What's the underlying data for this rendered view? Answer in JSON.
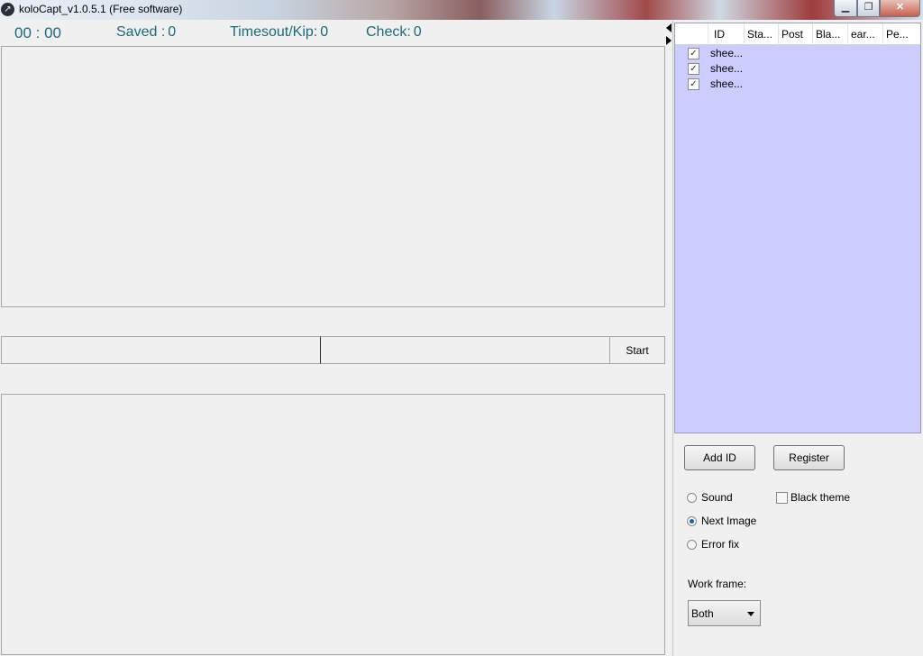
{
  "window": {
    "title": "koloCapt_v1.0.5.1 (Free software)",
    "icon": "app-icon",
    "controls": {
      "minimize": "minimize-icon",
      "maximize": "maximize-icon",
      "close": "close-icon"
    }
  },
  "stats": {
    "timer": "00 : 00",
    "saved_label": "Saved :",
    "saved_value": "0",
    "timeout_label": "Timesout/Kip:",
    "timeout_value": "0",
    "check_label": "Check:",
    "check_value": "0"
  },
  "controls": {
    "start_label": "Start",
    "input1_value": "",
    "input2_value": ""
  },
  "account_list": {
    "columns": [
      "",
      "ID",
      "Sta...",
      "Post",
      "Bla...",
      "ear...",
      "Pe..."
    ],
    "rows": [
      {
        "checked": true,
        "id": "shee..."
      },
      {
        "checked": true,
        "id": "shee..."
      },
      {
        "checked": true,
        "id": "shee..."
      }
    ],
    "background_color": "#ccccff"
  },
  "actions": {
    "add_id_label": "Add ID",
    "register_label": "Register"
  },
  "options": {
    "sound_label": "Sound",
    "sound_selected": false,
    "next_image_label": "Next Image",
    "next_image_selected": true,
    "error_fix_label": "Error fix",
    "error_fix_selected": false,
    "black_theme_label": "Black theme",
    "black_theme_checked": false
  },
  "work_frame": {
    "label": "Work frame:",
    "value": "Both"
  }
}
